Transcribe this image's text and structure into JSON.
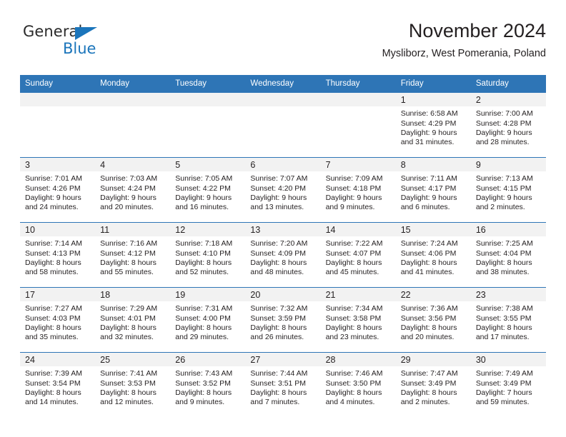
{
  "brand": {
    "name_part1": "General",
    "name_part2": "Blue",
    "triangle_color": "#1b75bb",
    "text_color": "#2b2b2b"
  },
  "header": {
    "title": "November 2024",
    "subtitle": "Mysliborz, West Pomerania, Poland"
  },
  "theme": {
    "header_bg": "#2e75b6",
    "header_text": "#ffffff",
    "daynum_band_bg": "#f2f2f2",
    "row_divider": "#2e75b6",
    "body_text": "#231f20"
  },
  "weekday_headers": [
    "Sunday",
    "Monday",
    "Tuesday",
    "Wednesday",
    "Thursday",
    "Friday",
    "Saturday"
  ],
  "weeks": [
    [
      {
        "day": "",
        "lines": []
      },
      {
        "day": "",
        "lines": []
      },
      {
        "day": "",
        "lines": []
      },
      {
        "day": "",
        "lines": []
      },
      {
        "day": "",
        "lines": []
      },
      {
        "day": "1",
        "lines": [
          "Sunrise: 6:58 AM",
          "Sunset: 4:29 PM",
          "Daylight: 9 hours",
          "and 31 minutes."
        ]
      },
      {
        "day": "2",
        "lines": [
          "Sunrise: 7:00 AM",
          "Sunset: 4:28 PM",
          "Daylight: 9 hours",
          "and 28 minutes."
        ]
      }
    ],
    [
      {
        "day": "3",
        "lines": [
          "Sunrise: 7:01 AM",
          "Sunset: 4:26 PM",
          "Daylight: 9 hours",
          "and 24 minutes."
        ]
      },
      {
        "day": "4",
        "lines": [
          "Sunrise: 7:03 AM",
          "Sunset: 4:24 PM",
          "Daylight: 9 hours",
          "and 20 minutes."
        ]
      },
      {
        "day": "5",
        "lines": [
          "Sunrise: 7:05 AM",
          "Sunset: 4:22 PM",
          "Daylight: 9 hours",
          "and 16 minutes."
        ]
      },
      {
        "day": "6",
        "lines": [
          "Sunrise: 7:07 AM",
          "Sunset: 4:20 PM",
          "Daylight: 9 hours",
          "and 13 minutes."
        ]
      },
      {
        "day": "7",
        "lines": [
          "Sunrise: 7:09 AM",
          "Sunset: 4:18 PM",
          "Daylight: 9 hours",
          "and 9 minutes."
        ]
      },
      {
        "day": "8",
        "lines": [
          "Sunrise: 7:11 AM",
          "Sunset: 4:17 PM",
          "Daylight: 9 hours",
          "and 6 minutes."
        ]
      },
      {
        "day": "9",
        "lines": [
          "Sunrise: 7:13 AM",
          "Sunset: 4:15 PM",
          "Daylight: 9 hours",
          "and 2 minutes."
        ]
      }
    ],
    [
      {
        "day": "10",
        "lines": [
          "Sunrise: 7:14 AM",
          "Sunset: 4:13 PM",
          "Daylight: 8 hours",
          "and 58 minutes."
        ]
      },
      {
        "day": "11",
        "lines": [
          "Sunrise: 7:16 AM",
          "Sunset: 4:12 PM",
          "Daylight: 8 hours",
          "and 55 minutes."
        ]
      },
      {
        "day": "12",
        "lines": [
          "Sunrise: 7:18 AM",
          "Sunset: 4:10 PM",
          "Daylight: 8 hours",
          "and 52 minutes."
        ]
      },
      {
        "day": "13",
        "lines": [
          "Sunrise: 7:20 AM",
          "Sunset: 4:09 PM",
          "Daylight: 8 hours",
          "and 48 minutes."
        ]
      },
      {
        "day": "14",
        "lines": [
          "Sunrise: 7:22 AM",
          "Sunset: 4:07 PM",
          "Daylight: 8 hours",
          "and 45 minutes."
        ]
      },
      {
        "day": "15",
        "lines": [
          "Sunrise: 7:24 AM",
          "Sunset: 4:06 PM",
          "Daylight: 8 hours",
          "and 41 minutes."
        ]
      },
      {
        "day": "16",
        "lines": [
          "Sunrise: 7:25 AM",
          "Sunset: 4:04 PM",
          "Daylight: 8 hours",
          "and 38 minutes."
        ]
      }
    ],
    [
      {
        "day": "17",
        "lines": [
          "Sunrise: 7:27 AM",
          "Sunset: 4:03 PM",
          "Daylight: 8 hours",
          "and 35 minutes."
        ]
      },
      {
        "day": "18",
        "lines": [
          "Sunrise: 7:29 AM",
          "Sunset: 4:01 PM",
          "Daylight: 8 hours",
          "and 32 minutes."
        ]
      },
      {
        "day": "19",
        "lines": [
          "Sunrise: 7:31 AM",
          "Sunset: 4:00 PM",
          "Daylight: 8 hours",
          "and 29 minutes."
        ]
      },
      {
        "day": "20",
        "lines": [
          "Sunrise: 7:32 AM",
          "Sunset: 3:59 PM",
          "Daylight: 8 hours",
          "and 26 minutes."
        ]
      },
      {
        "day": "21",
        "lines": [
          "Sunrise: 7:34 AM",
          "Sunset: 3:58 PM",
          "Daylight: 8 hours",
          "and 23 minutes."
        ]
      },
      {
        "day": "22",
        "lines": [
          "Sunrise: 7:36 AM",
          "Sunset: 3:56 PM",
          "Daylight: 8 hours",
          "and 20 minutes."
        ]
      },
      {
        "day": "23",
        "lines": [
          "Sunrise: 7:38 AM",
          "Sunset: 3:55 PM",
          "Daylight: 8 hours",
          "and 17 minutes."
        ]
      }
    ],
    [
      {
        "day": "24",
        "lines": [
          "Sunrise: 7:39 AM",
          "Sunset: 3:54 PM",
          "Daylight: 8 hours",
          "and 14 minutes."
        ]
      },
      {
        "day": "25",
        "lines": [
          "Sunrise: 7:41 AM",
          "Sunset: 3:53 PM",
          "Daylight: 8 hours",
          "and 12 minutes."
        ]
      },
      {
        "day": "26",
        "lines": [
          "Sunrise: 7:43 AM",
          "Sunset: 3:52 PM",
          "Daylight: 8 hours",
          "and 9 minutes."
        ]
      },
      {
        "day": "27",
        "lines": [
          "Sunrise: 7:44 AM",
          "Sunset: 3:51 PM",
          "Daylight: 8 hours",
          "and 7 minutes."
        ]
      },
      {
        "day": "28",
        "lines": [
          "Sunrise: 7:46 AM",
          "Sunset: 3:50 PM",
          "Daylight: 8 hours",
          "and 4 minutes."
        ]
      },
      {
        "day": "29",
        "lines": [
          "Sunrise: 7:47 AM",
          "Sunset: 3:49 PM",
          "Daylight: 8 hours",
          "and 2 minutes."
        ]
      },
      {
        "day": "30",
        "lines": [
          "Sunrise: 7:49 AM",
          "Sunset: 3:49 PM",
          "Daylight: 7 hours",
          "and 59 minutes."
        ]
      }
    ]
  ]
}
